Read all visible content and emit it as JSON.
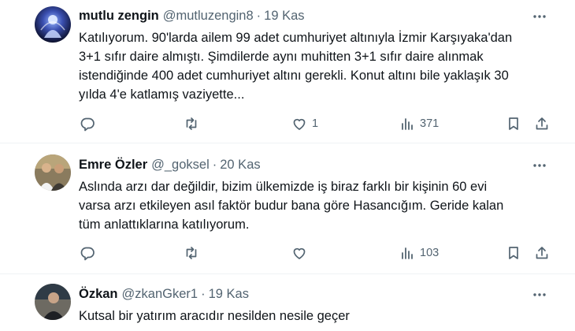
{
  "tweets": [
    {
      "name": "mutlu zengin",
      "handle": "@mutluzengin8",
      "separator": "·",
      "time": "19 Kas",
      "text": "Katılıyorum. 90'larda ailem 99 adet cumhuriyet altınıyla İzmir Karşıyaka'dan\n3+1 sıfır daire almıştı. Şimdilerde aynı muhitten 3+1 sıfır daire alınmak\nistendiğinde 400 adet cumhuriyet altını gerekli. Konut altını bile yaklaşık 30\nyılda 4'e katlamış vaziyette...",
      "likes": "1",
      "views": "371"
    },
    {
      "name": "Emre Özler",
      "handle": "@_goksel",
      "separator": "·",
      "time": "20 Kas",
      "text": "Aslında arzı dar değildir, bizim ülkemizde iş biraz farklı bir kişinin 60 evi\nvarsa arzı etkileyen asıl faktör budur bana göre Hasancığım. Geride kalan\ntüm anlattıklarına katılıyorum.",
      "likes": "",
      "views": "103"
    },
    {
      "name": "Özkan",
      "handle": "@zkanGker1",
      "separator": "·",
      "time": "19 Kas",
      "text": "Kutsal bir yatırım aracıdır nesilden nesile geçer"
    }
  ],
  "icons": {
    "reply": "reply-icon",
    "retweet": "retweet-icon",
    "like": "heart-icon",
    "views": "views-icon",
    "bookmark": "bookmark-icon",
    "share": "share-icon",
    "more": "more-icon"
  },
  "colors": {
    "text": "#0f1419",
    "secondary": "#536471",
    "divider": "#eff3f4"
  }
}
